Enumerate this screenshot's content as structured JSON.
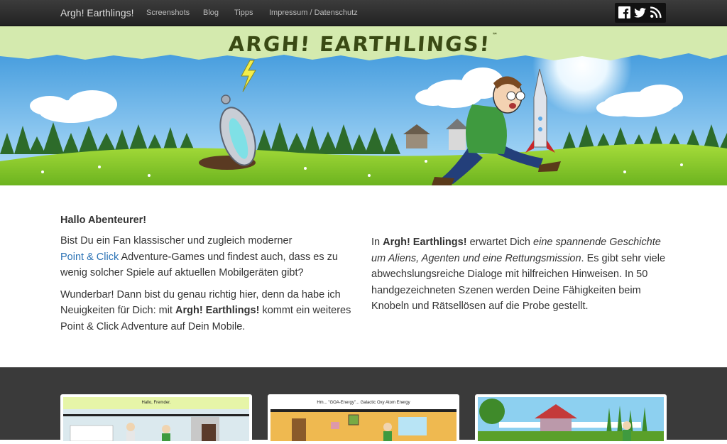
{
  "navbar": {
    "brand": "Argh! Earthlings!",
    "links": [
      "Screenshots",
      "Blog",
      "Tipps",
      "Impressum / Datenschutz"
    ],
    "social_icons": [
      "facebook-icon",
      "twitter-icon",
      "rss-icon"
    ]
  },
  "hero": {
    "logo": "ARGH! EARTHLINGS!",
    "trademark": "™"
  },
  "intro": {
    "heading": "Hallo Abenteurer!",
    "p1_before": "Bist Du ein Fan klassischer und zugleich moderner",
    "p1_link": "Point & Click",
    "p1_after": "Adventure-Games und findest auch, dass es zu wenig solcher Spiele auf aktuellen Mobilgeräten gibt?",
    "p2_before": "Wunderbar! Dann bist du genau richtig hier, denn da habe ich Neuigkeiten für Dich: mit",
    "p2_bold": "Argh! Earthlings!",
    "p2_after": "kommt ein weiteres Point & Click Adventure auf Dein Mobile."
  },
  "details": {
    "in": "In",
    "title_bold": "Argh! Earthlings!",
    "waits": "erwartet Dich",
    "italic": "eine spannende Geschichte um Aliens, Agenten und eine Rettungsmission",
    "rest": ". Es gibt sehr viele abwechslungsreiche Dialoge mit hilfreichen Hinweisen. In 50 handgezeichneten Szenen werden Deine Fähigkeiten beim Knobeln und Rätsellösen auf die Probe gestellt."
  },
  "screenshots": [
    {
      "caption": "Hallo, Fremder."
    },
    {
      "caption": "Hm... \"GOA-Energy\"... Galactic Oxy Atom Energy"
    },
    {
      "caption": ""
    }
  ],
  "colors": {
    "navbar": "#2b2b2b",
    "link": "#2a72b5",
    "band": "#3a3a3a",
    "sky": "#5fb3ea",
    "grass": "#8ccf2a",
    "logo_band": "#d7ebb0"
  }
}
